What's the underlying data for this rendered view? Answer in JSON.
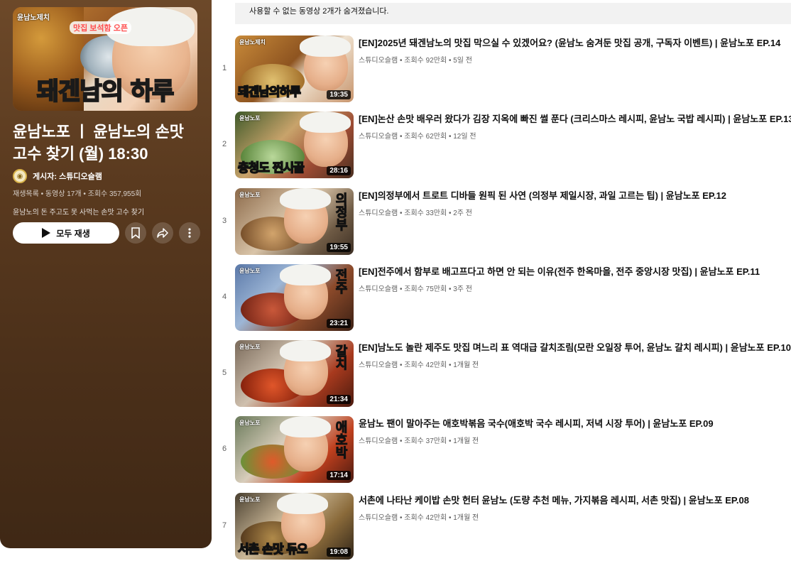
{
  "playlist": {
    "thumbnail_logo": "윤남노제치",
    "thumbnail_badge": "맛집 보석함 오픈",
    "thumbnail_caption_highlight": "돼겐남",
    "thumbnail_caption_rest": "의 하루",
    "title": "윤남노포 ㅣ 윤남노의 손맛 고수 찾기 (월) 18:30",
    "owner_prefix": "게시자: ",
    "owner": "스튜디오슬램",
    "meta": "재생목록 • 동영상 17개 • 조회수 357,955회",
    "description": "윤남노의 돈 주고도 못 사먹는 손맛 고수 찾기",
    "play_all_label": "모두 재생",
    "accent_color": "#5a3a1f"
  },
  "notice": "사용할 수 없는 동영상 2개가 숨겨졌습니다.",
  "videos": [
    {
      "index": "1",
      "title": "[EN]2025년 돼겐남노의 맛집 막으실 수 있겠어요? (윤남노 숨겨둔 맛집 공개, 구독자 이벤트) | 윤남노포 EP.14",
      "channel": "스튜디오슬램",
      "views": "조회수 92만회",
      "age": "5일 전",
      "duration": "19:35",
      "thumb_logo": "윤남노제치",
      "cap_hl": "돼겐남",
      "cap_rest": "의하루",
      "vcap": ""
    },
    {
      "index": "2",
      "title": "[EN]논산 손맛 배우러 왔다가 김장 지옥에 빠진 썰 푼다 (크리스마스 레시피, 윤남노 국밥 레시피) | 윤남노포 EP.13",
      "channel": "스튜디오슬램",
      "views": "조회수 62만회",
      "age": "12일 전",
      "duration": "28:16",
      "thumb_logo": "윤남노포",
      "cap_hl": "찐시골",
      "cap_rest": "충청도 ",
      "vcap": ""
    },
    {
      "index": "3",
      "title": "[EN]의정부에서 트로트 디바들 원픽 된 사연 (의정부 제일시장, 과일 고르는 팁) | 윤남노포 EP.12",
      "channel": "스튜디오슬램",
      "views": "조회수 33만회",
      "age": "2주 전",
      "duration": "19:55",
      "thumb_logo": "윤남노포",
      "cap_hl": "",
      "cap_rest": "",
      "vcap": "의정부"
    },
    {
      "index": "4",
      "title": "[EN]전주에서 함부로 배고프다고 하면 안 되는 이유(전주 한옥마을, 전주 중앙시장 맛집) | 윤남노포 EP.11",
      "channel": "스튜디오슬램",
      "views": "조회수 75만회",
      "age": "3주 전",
      "duration": "23:21",
      "thumb_logo": "윤남노포",
      "cap_hl": "",
      "cap_rest": "",
      "vcap": "전주"
    },
    {
      "index": "5",
      "title": "[EN]남노도 놀란 제주도 맛집 며느리 표 역대급 갈치조림(모란 오일장 투어, 윤남노 갈치 레시피) | 윤남노포 EP.10",
      "channel": "스튜디오슬램",
      "views": "조회수 42만회",
      "age": "1개월 전",
      "duration": "21:34",
      "thumb_logo": "윤남노포",
      "cap_hl": "",
      "cap_rest": "",
      "vcap": "갈치"
    },
    {
      "index": "6",
      "title": "윤남노 팬이 말아주는 애호박볶음 국수(애호박 국수 레시피, 저녁 시장 투어) | 윤남노포 EP.09",
      "channel": "스튜디오슬램",
      "views": "조회수 37만회",
      "age": "1개월 전",
      "duration": "17:14",
      "thumb_logo": "윤남노포",
      "cap_hl": "",
      "cap_rest": "",
      "vcap": "애호박"
    },
    {
      "index": "7",
      "title": "서촌에 나타난 케이밥 손맛 헌터 윤남노 (도량 추천 메뉴, 가지볶음 레시피, 서촌 맛집) | 윤남노포 EP.08",
      "channel": "스튜디오슬램",
      "views": "조회수 42만회",
      "age": "1개월 전",
      "duration": "19:08",
      "thumb_logo": "윤남노포",
      "cap_hl": "서촌",
      "cap_rest": " 손맛 듀오",
      "vcap": ""
    }
  ]
}
